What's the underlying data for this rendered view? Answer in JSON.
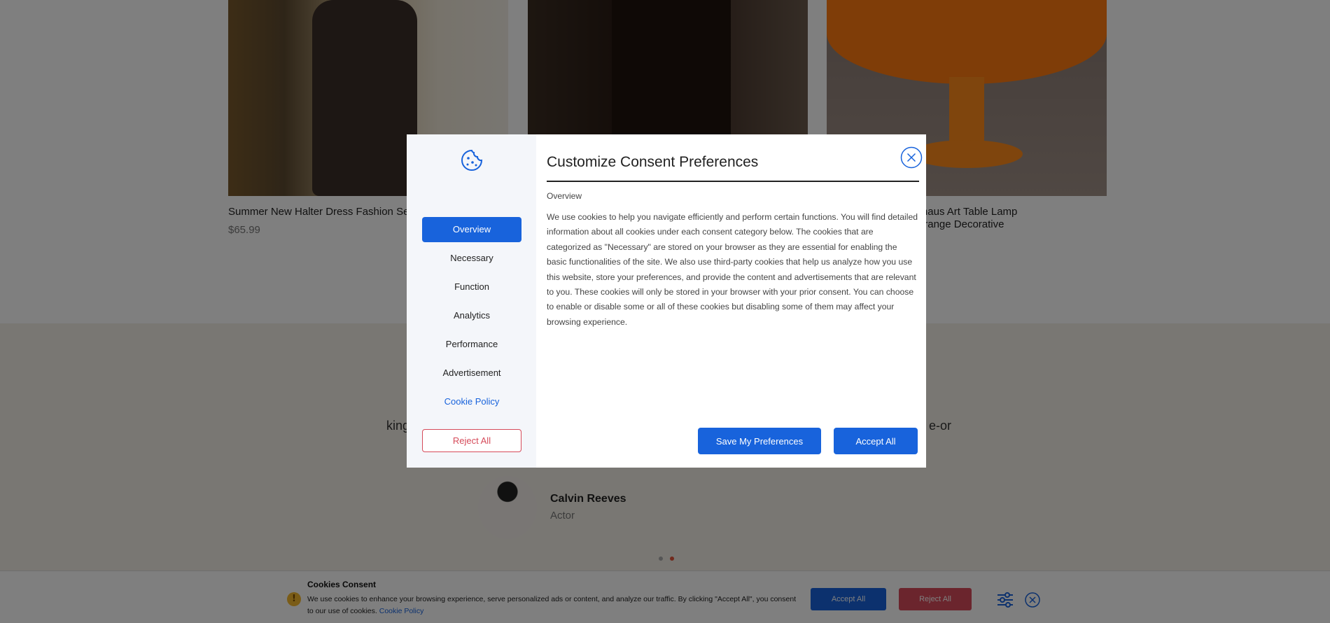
{
  "products": [
    {
      "title": "Summer New Halter Dress Fashion Sexy B",
      "price": "$65.99"
    },
    {
      "title": "",
      "price": ""
    },
    {
      "title_line1": "e Lamp Modern Bauhaus Art Table Lamp",
      "title_line2": "e Danish Designer Orange Decorative"
    }
  ],
  "testimonial": {
    "quote_left_fragment": "king",
    "quote_right_fragment": "e-or",
    "name": "Calvin Reeves",
    "role": "Actor"
  },
  "cookie_bar": {
    "title": "Cookies Consent",
    "text": "We use cookies to enhance your browsing experience, serve personalized ads or content, and analyze our traffic. By clicking \"Accept All\", you consent to our use of cookies.",
    "policy_link": "Cookie Policy",
    "accept_label": "Accept All",
    "reject_label": "Reject All",
    "warning_icon": "!"
  },
  "modal": {
    "title": "Customize Consent Preferences",
    "section_title": "Overview",
    "body": "We use cookies to help you navigate efficiently and perform certain functions. You will find detailed information about all cookies under each consent category below. The cookies that are categorized as \"Necessary\" are stored on your browser as they are essential for enabling the basic functionalities of the site. We also use third-party cookies that help us analyze how you use this website, store your preferences, and provide the content and advertisements that are relevant to you. These cookies will only be stored in your browser with your prior consent. You can choose to enable or disable some or all of these cookies but disabling some of them may affect your browsing experience.",
    "nav": [
      "Overview",
      "Necessary",
      "Function",
      "Analytics",
      "Performance",
      "Advertisement"
    ],
    "cookie_policy": "Cookie Policy",
    "reject_all": "Reject All",
    "save_prefs": "Save My Preferences",
    "accept_all": "Accept All"
  },
  "colors": {
    "accent": "#1863dc",
    "reject": "#d64b5a",
    "overlay": "rgba(0,0,0,0.5)"
  }
}
